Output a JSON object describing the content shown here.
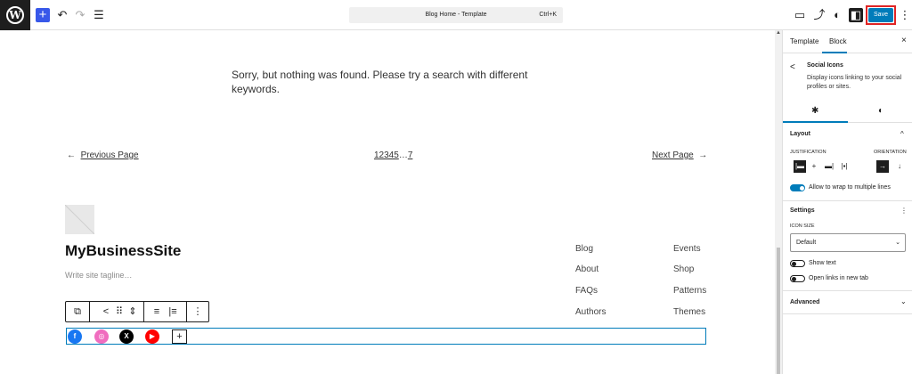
{
  "topbar": {
    "logo_letter": "W",
    "add_icon": "+",
    "undo_icon": "↶",
    "redo_icon": "↷",
    "list_view_icon": "☰",
    "doc_title": "Blog Home - Template",
    "shortcut": "Ctrl+K",
    "device_icon": "▭",
    "external_icon": "⤴",
    "styles_icon": "◐",
    "sidebar_icon": "◧",
    "save_label": "Save",
    "options_icon": "⋮"
  },
  "canvas": {
    "nothing_found": "Sorry, but nothing was found. Please try a search with different keywords.",
    "pagination": {
      "prev_arrow": "←",
      "prev_label": "Previous Page",
      "pages": "12345",
      "ellipsis": "…",
      "last_page": "7",
      "next_label": "Next Page",
      "next_arrow": "→"
    },
    "site_title": "MyBusinessSite",
    "tagline": "Write site tagline…",
    "nav_col1": [
      "Blog",
      "About",
      "FAQs",
      "Authors"
    ],
    "nav_col2": [
      "Events",
      "Shop",
      "Patterns",
      "Themes"
    ],
    "block_toolbar": {
      "transform_icon": "⧉",
      "share_icon": "<",
      "drag_icon": "⠿",
      "move_icon": "⇕",
      "justify_icon": "≡",
      "align_icon": "|≡",
      "more_icon": "⋮"
    },
    "social": [
      {
        "name": "facebook",
        "glyph": "f",
        "color": "#1877f2"
      },
      {
        "name": "instagram",
        "glyph": "◎",
        "color": "#f06dbf"
      },
      {
        "name": "x",
        "glyph": "X",
        "color": "#000000"
      },
      {
        "name": "youtube",
        "glyph": "▶",
        "color": "#ff0000"
      }
    ],
    "add_icon": "+"
  },
  "sidebar": {
    "tabs": [
      "Template",
      "Block"
    ],
    "active_tab": "Block",
    "close_icon": "×",
    "block_icon": "<",
    "block_name": "Social Icons",
    "block_desc": "Display icons linking to your social profiles or sites.",
    "settings_tab_icon": "✱",
    "styles_tab_icon": "◐",
    "layout": {
      "title": "Layout",
      "collapse_icon": "^",
      "justification_label": "JUSTIFICATION",
      "orientation_label": "ORIENTATION",
      "justify_buttons": [
        "|▬",
        "+",
        "▬|",
        "|▪|"
      ],
      "orientation_buttons": [
        "→",
        "↓"
      ],
      "wrap_label": "Allow to wrap to multiple lines",
      "wrap_on": true
    },
    "settings": {
      "title": "Settings",
      "menu_icon": "⋮",
      "icon_size_label": "ICON SIZE",
      "icon_size_value": "Default",
      "select_chevron": "⌄",
      "show_text": "Show text",
      "new_tab": "Open links in new tab"
    },
    "advanced": {
      "title": "Advanced",
      "chevron": "⌄"
    },
    "accent": "#007cba"
  }
}
